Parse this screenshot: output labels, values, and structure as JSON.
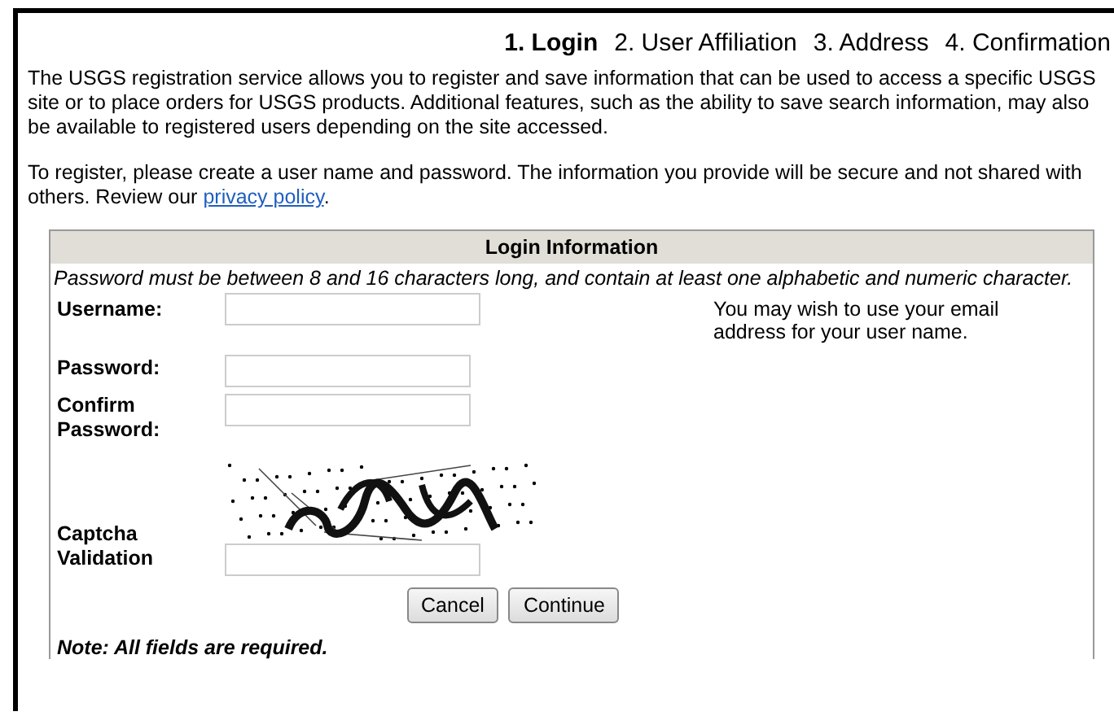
{
  "steps": [
    {
      "label": "1. Login",
      "selected": true
    },
    {
      "label": "2. User Affiliation",
      "selected": false
    },
    {
      "label": "3. Address",
      "selected": false
    },
    {
      "label": "4. Confirmation",
      "selected": false
    }
  ],
  "intro": "The USGS registration service allows you to register and save information that can be used to access a specific USGS site or to place orders for USGS products. Additional features, such as the ability to save search information, may also be available to registered users depending on the site accessed.",
  "register": {
    "text": "To register, please create a user name and password. The information you provide will be secure and not shared with others. Review our",
    "link": "privacy policy",
    "after": "."
  },
  "form": {
    "title": "Login Information",
    "rule": "Password must be between 8 and 16 characters long, and contain at least one alphabetic and numeric character.",
    "fields": [
      {
        "kind": "text",
        "label": "Username:",
        "hint": "You may wish to use your email address for your user name."
      },
      {
        "kind": "text",
        "label": "Password:"
      },
      {
        "kind": "text",
        "label": "Confirm Password:"
      },
      {
        "kind": "captcha",
        "label": "Captcha Validation"
      }
    ],
    "buttons": [
      "Cancel",
      "Continue"
    ],
    "note": "Note: All fields are required."
  }
}
